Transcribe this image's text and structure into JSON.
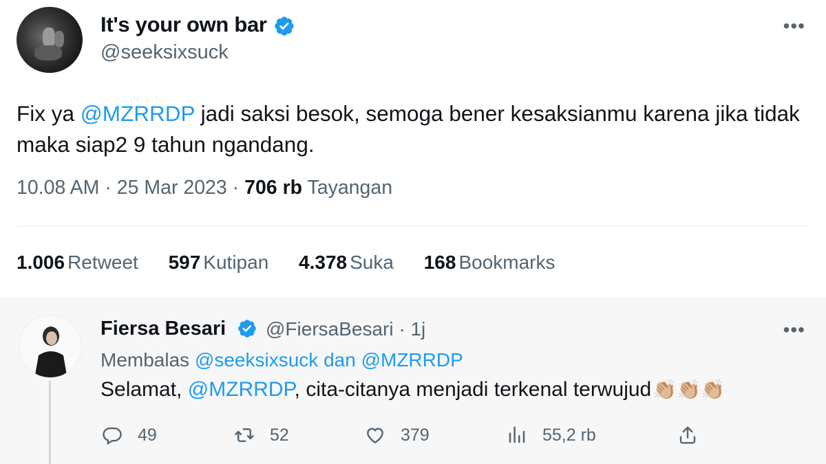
{
  "main_tweet": {
    "display_name": "It's your own bar",
    "handle": "@seeksixsuck",
    "more_label": "•••",
    "text_before": "Fix ya ",
    "mention": "@MZRRDP",
    "text_after": " jadi saksi besok, semoga bener kesaksianmu karena jika tidak maka siap2 9 tahun ngandang.",
    "time": "10.08 AM · 25 Mar 2023 · ",
    "views_count": "706 rb",
    "views_label": " Tayangan",
    "stats": [
      {
        "num": "1.006",
        "label": "Retweet"
      },
      {
        "num": "597",
        "label": "Kutipan"
      },
      {
        "num": "4.378",
        "label": "Suka"
      },
      {
        "num": "168",
        "label": "Bookmarks"
      }
    ]
  },
  "reply": {
    "display_name": "Fiersa Besari",
    "handle_time": "@FiersaBesari · 1j",
    "more_label": "•••",
    "replying_prefix": "Membalas ",
    "replying_to": "@seeksixsuck dan @MZRRDP",
    "text_before": "Selamat, ",
    "mention": "@MZRRDP",
    "text_after": ", cita-citanya menjadi terkenal terwujud",
    "emoji": "👏🏼👏🏼👏🏼",
    "actions": {
      "replies": "49",
      "retweets": "52",
      "likes": "379",
      "views": "55,2 rb"
    }
  },
  "colors": {
    "accent": "#1d9bf0",
    "secondary_text": "#536471",
    "primary_text": "#0f1419"
  }
}
